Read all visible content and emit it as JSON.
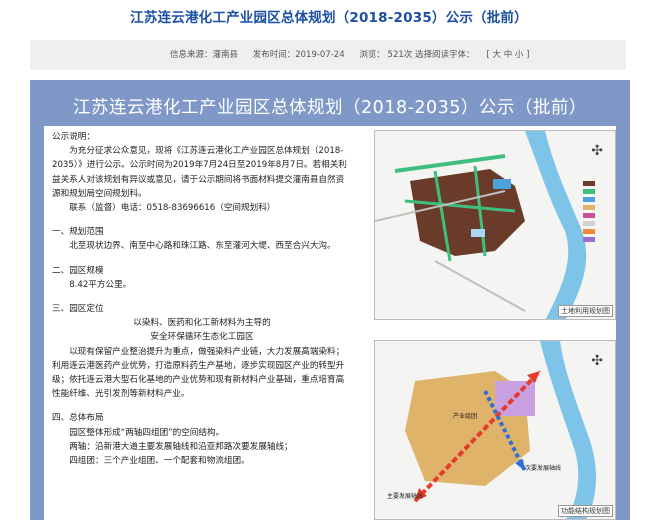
{
  "article": {
    "title": "江苏连云港化工产业园区总体规划（2018-2035）公示（批前）"
  },
  "meta": {
    "source": "信息来源：灌南县",
    "date": "发布时间：2019-07-24",
    "views": "浏览： 521次 选择阅读字体：",
    "font_size": "[ 大 中 小 ]"
  },
  "poster": {
    "title": "江苏连云港化工产业园区总体规划（2018-2035）公示（批前）",
    "notice_heading": "公示说明：",
    "notice_body": "为充分征求公众意见，现将《江苏连云港化工产业园区总体规划（2018-2035）》进行公示。公示时间为2019年7月24日至2019年8月7日。若相关利益关系人对该规划有异议或意见，请于公示期间将书面材料提交灌南县自然资源和规划局空间规划科。",
    "contact": "联系（监督）电话：0518-83696616（空间规划科）",
    "s1_title": "一、规划范围",
    "s1_body": "北至现状边界、南至中心路和珠江路、东至灌河大堤、西至合兴大沟。",
    "s2_title": "二、园区规模",
    "s2_body": "8.42平方公里。",
    "s3_title": "三、园区定位",
    "s3_line1": "以染料、医药和化工新材料为主导的",
    "s3_line2": "安全环保循环生态化工园区",
    "s3_body": "以现有保留产业整治提升为重点，做强染料产业链，大力发展高端染料；利用连云港医药产业优势，打造原料药生产基地，逐步实现园区产业的转型升级；依托连云港大型石化基地的产业优势和现有新材料产业基础，重点培育高性能纤维、光引发剂等新材料产业。",
    "s4_title": "四、总体布局",
    "s4_body1": "园区整体形成“两轴四组团”的空间结构。",
    "s4_body2": "两轴：沿新港大道主要发展轴线和沿亚邦路次要发展轴线；",
    "s4_body3": "四组团：三个产业组团、一个配套和物流组团。"
  },
  "maps": {
    "map1_caption": "土地利用规划图",
    "map2_caption": "功能结构规划图",
    "map2_label_main_axis": "主要发展轴线",
    "map2_label_sub_axis": "次要发展轴线",
    "map2_label_cluster": "产业组团"
  },
  "colors": {
    "title_blue": "#1c4fa3",
    "poster_bg": "#7f98c7",
    "industrial": "#6b3b2a",
    "green": "#3fbf7f",
    "water": "#4aa3df",
    "cluster": "#e0b36a",
    "axis_red": "#e53b2c",
    "axis_blue": "#2f6fd6"
  }
}
